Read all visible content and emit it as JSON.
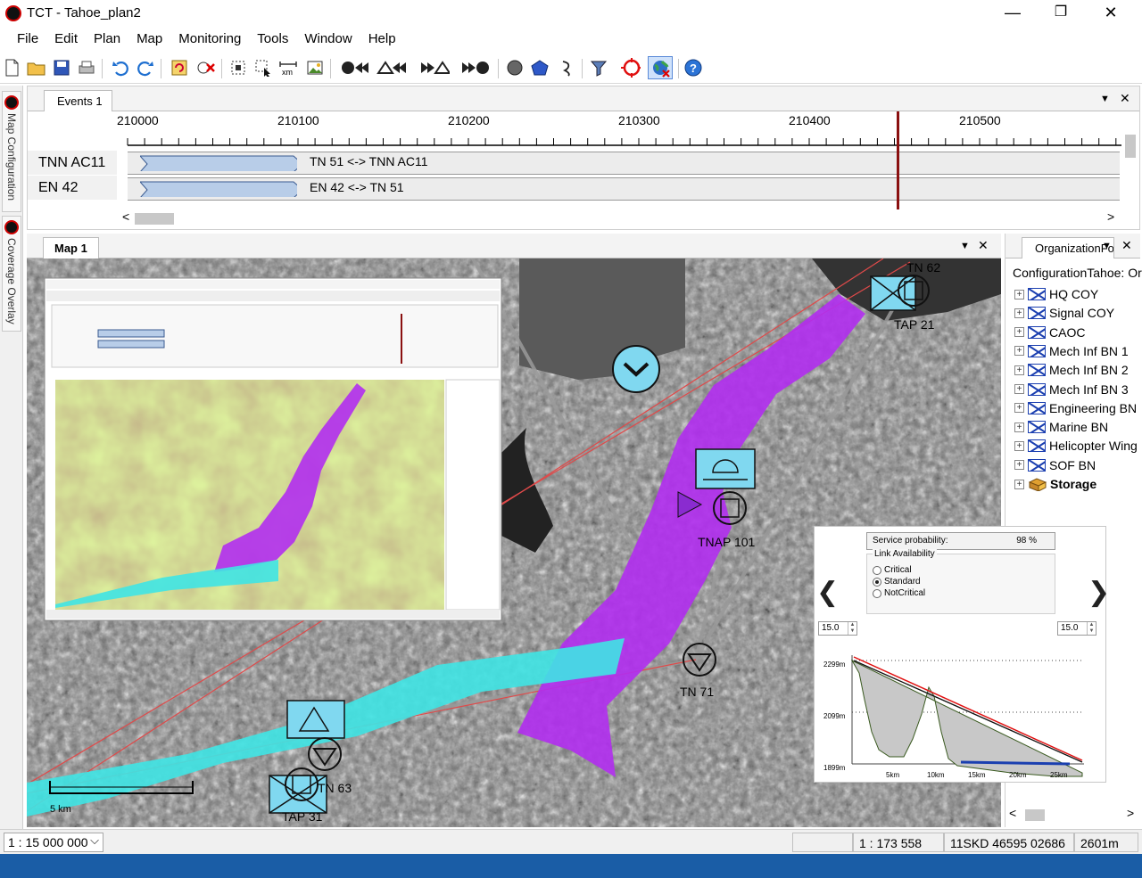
{
  "window": {
    "title": "TCT - Tahoe_plan2",
    "minimize_glyph": "—",
    "maximize_glyph": "❐",
    "close_glyph": "✕"
  },
  "menu": [
    "File",
    "Edit",
    "Plan",
    "Map",
    "Monitoring",
    "Tools",
    "Window",
    "Help"
  ],
  "toolbar_icons": [
    "new-file-icon",
    "open-folder-icon",
    "save-icon",
    "print-icon",
    "undo-icon",
    "redo-icon",
    "refresh-icon",
    "delete-icon",
    "select-icon",
    "area-select-icon",
    "measure-icon",
    "image-icon",
    "play-start-icon",
    "rewind-icon",
    "forward-icon",
    "play-end-icon",
    "circle-icon",
    "polygon-icon",
    "line-icon",
    "filter-icon",
    "target-icon",
    "globe-icon",
    "help-icon"
  ],
  "side_tabs": [
    "Map Configuration",
    "Coverage Overlay"
  ],
  "events": {
    "tab_label": "Events 1",
    "panel_menu_glyph": "▼",
    "panel_close_glyph": "✕",
    "ticks": [
      "210000",
      "210100",
      "210200",
      "210300",
      "210400",
      "210500"
    ],
    "rows": [
      {
        "name": "TNN AC11",
        "event": "TN 51 <-> TNN AC11"
      },
      {
        "name": "EN 42",
        "event": "EN 42 <-> TN 51"
      }
    ],
    "scroll_left": "<",
    "scroll_right": ">"
  },
  "map": {
    "tab_label": "Map 1",
    "panel_menu_glyph": "▼",
    "panel_close_glyph": "✕",
    "units": [
      {
        "label": "TN 62"
      },
      {
        "label": "TAP 21"
      },
      {
        "label": "TNAP 101"
      },
      {
        "label": "TN 71"
      },
      {
        "label": "TN 63"
      },
      {
        "label": "TAP 31"
      }
    ],
    "scale_bar_label": "5 km"
  },
  "org": {
    "tab_label": "OrganizationForm",
    "root_label": "ConfigurationTahoe: Org",
    "expand_glyph": "+",
    "items": [
      "HQ COY",
      "Signal COY",
      "CAOC",
      "Mech Inf BN 1",
      "Mech Inf BN 2",
      "Mech Inf BN 3",
      "Engineering BN",
      "Marine BN",
      "Helicopter Wing",
      "SOF BN"
    ],
    "storage_label": "Storage"
  },
  "profile": {
    "service_probability_label": "Service probability:",
    "service_probability_value": "98 %",
    "link_availability_title": "Link Availability",
    "options": [
      "Critical",
      "Standard",
      "NotCritical"
    ],
    "selected": "Standard",
    "left_height": "15.0",
    "right_height": "15.0",
    "spin_up": "▲",
    "spin_down": "▼",
    "nav_left": "❮",
    "nav_right": "❯",
    "y_labels": [
      "2299m",
      "2099m",
      "1899m"
    ],
    "x_labels": [
      "5km",
      "10km",
      "15km",
      "20km",
      "25km"
    ]
  },
  "status": {
    "scale": "1 : 15 000 000",
    "scale_dropdown_glyph": "⌵",
    "map_scale": "1 : 173 558",
    "coordinate": "11SKD 46595 02686",
    "elevation": "2601m"
  },
  "colors": {
    "coverage_magenta": "#b12ef0",
    "coverage_cyan": "#3fe4e4",
    "unit_fill": "#80d8f0",
    "link_line": "#e04a4a",
    "profile_terrain": "#c8c8c8"
  }
}
